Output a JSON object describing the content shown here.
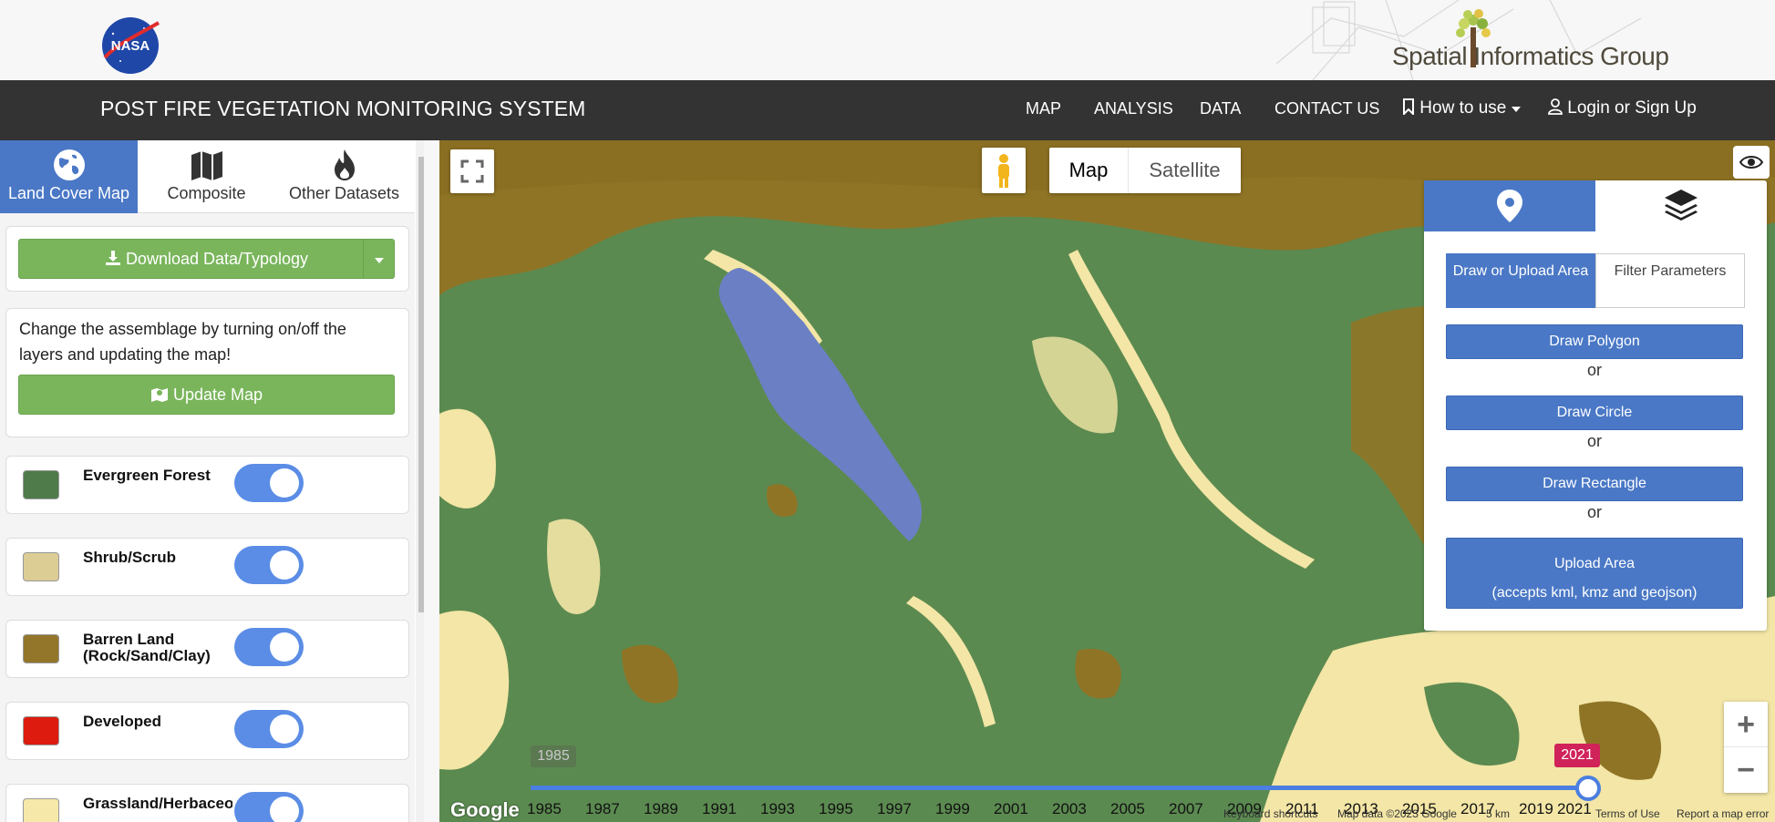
{
  "header": {
    "org_logo_text": "NASA",
    "partner_name": "Spatial Informatics Group"
  },
  "navbar": {
    "brand": "POST FIRE VEGETATION MONITORING SYSTEM",
    "links": {
      "map": "MAP",
      "analysis": "ANALYSIS",
      "data": "DATA",
      "contact": "CONTACT US",
      "how_to_use": "How to use",
      "login": "Login or Sign Up"
    }
  },
  "sidebar": {
    "tabs": [
      {
        "label": "Land Cover Map",
        "icon": "globe-icon",
        "active": true
      },
      {
        "label": "Composite",
        "icon": "map-icon",
        "active": false
      },
      {
        "label": "Other Datasets",
        "icon": "fire-icon",
        "active": false
      }
    ],
    "download_label": "Download Data/Typology",
    "instructions": "Change the assemblage by turning on/off the layers and updating the map!",
    "update_label": "Update Map",
    "layers": [
      {
        "label": "Evergreen Forest",
        "color": "#4e7b49",
        "on": true
      },
      {
        "label": "Shrub/Scrub",
        "color": "#dccd95",
        "on": true
      },
      {
        "label": "Barren Land (Rock/Sand/Clay)",
        "color": "#93762a",
        "on": true
      },
      {
        "label": "Developed",
        "color": "#dd1c0f",
        "on": true
      },
      {
        "label": "Grassland/Herbaceous",
        "color": "#f6e8a8",
        "on": true
      }
    ]
  },
  "map": {
    "map_type": {
      "map": "Map",
      "satellite": "Satellite",
      "selected": "Map"
    },
    "draw_panel": {
      "subtabs": {
        "draw": "Draw or Upload Area",
        "filter": "Filter Parameters"
      },
      "draw_polygon": "Draw Polygon",
      "draw_circle": "Draw Circle",
      "draw_rectangle": "Draw Rectangle",
      "upload_area": "Upload Area",
      "upload_hint": "(accepts kml, kmz and geojson)",
      "or": "or"
    },
    "zoom_in": "+",
    "zoom_out": "−",
    "timeline": {
      "min_label": "1985",
      "selected_year": "2021",
      "ticks": [
        "1985",
        "1987",
        "1989",
        "1991",
        "1993",
        "1995",
        "1997",
        "1999",
        "2001",
        "2003",
        "2005",
        "2007",
        "2009",
        "2011",
        "2013",
        "2015",
        "2017",
        "2019",
        "2021"
      ]
    },
    "google": "Google",
    "attribution": {
      "shortcuts": "Keyboard shortcuts",
      "mapdata": "Map data ©2023 Google",
      "scale": "5 km",
      "terms": "Terms of Use",
      "report": "Report a map error"
    },
    "colors": {
      "forest": "#5b8a50",
      "shrub": "#f3e6a6",
      "barren": "#8f7425",
      "burn": "#6b7fc4"
    }
  }
}
